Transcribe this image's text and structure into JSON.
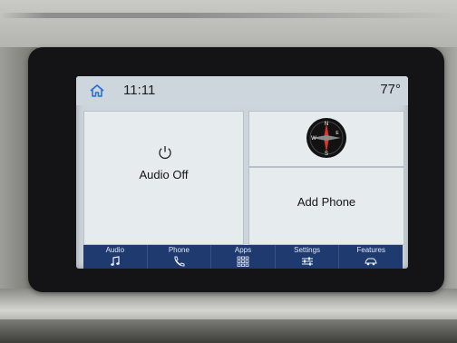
{
  "status_bar": {
    "home_icon": "home-icon",
    "time": "11:11",
    "temperature": "77°"
  },
  "tiles": {
    "audio": {
      "label": "Audio Off",
      "icon": "power-icon"
    },
    "compass": {
      "icon": "compass-icon",
      "letters": [
        "N",
        "E",
        "S",
        "W"
      ]
    },
    "phone": {
      "label": "Add Phone"
    }
  },
  "nav": {
    "items": [
      {
        "label": "Audio",
        "icon": "music-note-icon"
      },
      {
        "label": "Phone",
        "icon": "phone-icon"
      },
      {
        "label": "Apps",
        "icon": "apps-grid-icon"
      },
      {
        "label": "Settings",
        "icon": "sliders-icon"
      },
      {
        "label": "Features",
        "icon": "car-icon"
      }
    ]
  },
  "colors": {
    "screen_background": "#ccd5db",
    "tile_background": "#e6ebee",
    "nav_background": "#1f3a6e",
    "accent_blue": "#2a6fd6",
    "compass_red": "#d8352a"
  }
}
